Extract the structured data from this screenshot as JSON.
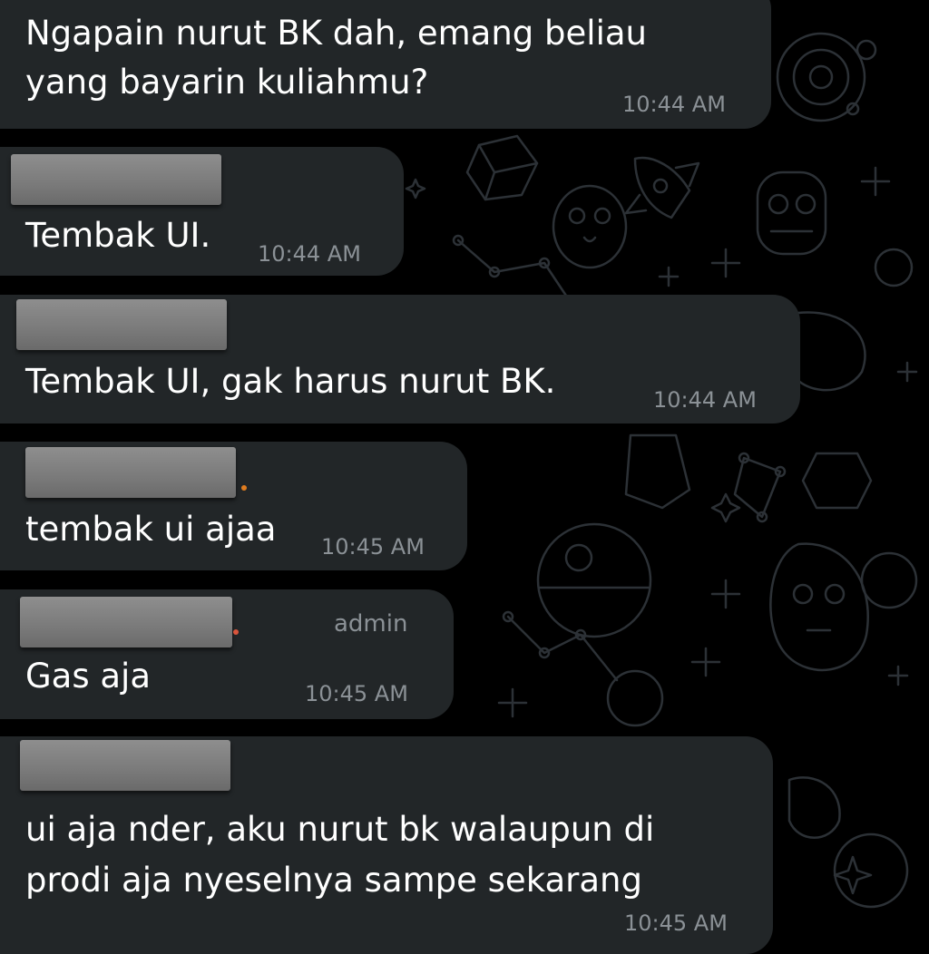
{
  "colors": {
    "background": "#000000",
    "bubble": "#222628",
    "text": "#ffffff",
    "meta": "#8b9196",
    "wallpaper_doodle": "#2c3136",
    "sender_dot_orange": "#e07c1f",
    "sender_dot_red": "#d9553c"
  },
  "wallpaper": {
    "doodles": [
      "planet-icon",
      "gem-icon",
      "rocket-icon",
      "astronaut-icon",
      "porg-icon",
      "constellation-icon",
      "death-star-icon",
      "droid-icon",
      "sparkle-icon",
      "star-icon"
    ]
  },
  "messages": [
    {
      "text_lines": [
        "Ngapain nurut BK dah, emang beliau",
        "yang bayarin kuliahmu?"
      ],
      "time": "10:44 AM"
    },
    {
      "sender": "[redacted]",
      "text_lines": [
        "Tembak UI."
      ],
      "time": "10:44 AM"
    },
    {
      "sender": "[redacted]",
      "text_lines": [
        "Tembak UI, gak harus nurut BK."
      ],
      "time": "10:44 AM"
    },
    {
      "sender": "[redacted]",
      "text_lines": [
        "tembak ui ajaa"
      ],
      "time": "10:45 AM"
    },
    {
      "sender": "[redacted]",
      "badge": "admin",
      "text_lines": [
        "Gas aja"
      ],
      "time": "10:45 AM"
    },
    {
      "sender": "[redacted]",
      "text_lines": [
        "ui aja nder, aku nurut bk walaupun di",
        "prodi aja nyeselnya sampe sekarang"
      ],
      "time": "10:45 AM"
    }
  ]
}
